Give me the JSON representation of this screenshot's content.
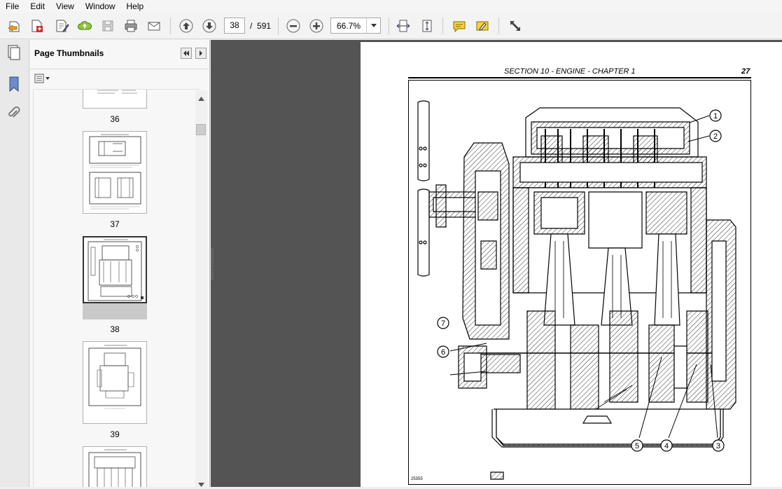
{
  "menu": [
    "File",
    "Edit",
    "View",
    "Window",
    "Help"
  ],
  "toolbar": {
    "current_page": "38",
    "page_separator": "/",
    "total_pages": "591",
    "zoom": "66.7%"
  },
  "thumbnails": {
    "title": "Page Thumbnails",
    "pages": [
      {
        "label": "36"
      },
      {
        "label": "37"
      },
      {
        "label": "38",
        "selected": true
      },
      {
        "label": "39"
      }
    ]
  },
  "document": {
    "header": "SECTION 10 - ENGINE - CHAPTER 1",
    "page_number": "27",
    "figure_code": "25355",
    "callouts": [
      "1",
      "2",
      "3",
      "4",
      "5",
      "6",
      "7"
    ]
  },
  "colors": {
    "doc_background": "#545454",
    "panel": "#f7f7f7",
    "selected_thumb": "#c9c9c9"
  }
}
